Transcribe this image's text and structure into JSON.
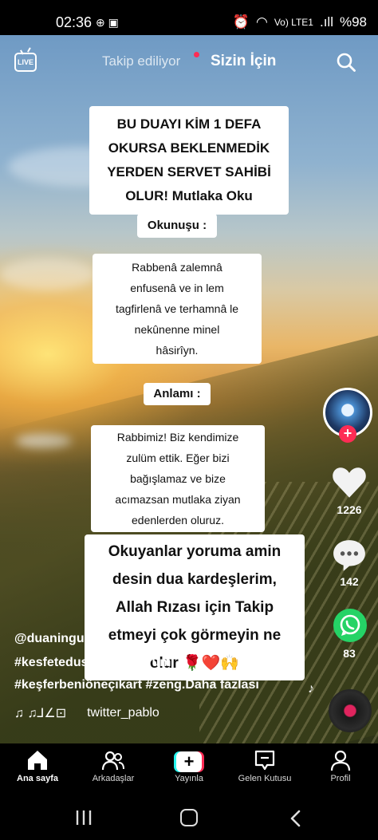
{
  "status_bar": {
    "time": "02:36",
    "notification_icons": "⊕ ▣",
    "network_label": "Vo) LTE1",
    "signal": ".ıll",
    "battery": "%98"
  },
  "top_nav": {
    "following_tab": "Takip ediliyor",
    "for_you_tab": "Sizin İçin",
    "live_label": "LIVE"
  },
  "captions": {
    "title_lines": [
      "BU DUAYI KİM 1 DEFA",
      "OKURSA BEKLENMEDİK",
      "YERDEN SERVET SAHİBİ",
      "OLUR! Mutlaka Oku"
    ],
    "reading_label": "Okunuşu :",
    "reading_lines": [
      "Rabbenâ zalemnâ",
      "enfusenâ ve in lem",
      "tagfirlenâ ve terhamnâ le",
      "nekûnenne minel",
      "hâsirîyn."
    ],
    "meaning_label": "Anlamı :",
    "meaning_lines": [
      "Rabbimiz! Biz kendimize",
      "zulüm ettik. Eğer bizi",
      "bağışlamaz ve bize",
      "acımazsan mutlaka ziyan",
      "edenlerden oluruz."
    ],
    "request_lines": [
      "Okuyanlar yoruma amin",
      "desin dua kardeşlerim,",
      "Allah Rızası için Takip",
      "etmeyi çok görmeyin ne",
      "olur 🌹❤️🙌"
    ]
  },
  "actions": {
    "likes": "1226",
    "comments": "142",
    "shares": "83",
    "follow_symbol": "+"
  },
  "post_info": {
    "username": "@duaningucu",
    "hashtags_line1": "#kesfetedusmekistiyorum",
    "hashtags_line2": "#keşferbeniöneçıkart #zeng.",
    "more_label": "Daha fazlası",
    "music_glyphs": "♫  ♫⅃∠⊡",
    "music_author": "twitter_pablo"
  },
  "bottom_nav": [
    {
      "label": "Ana sayfa"
    },
    {
      "label": "Arkadaşlar"
    },
    {
      "label": "Yayınla"
    },
    {
      "label": "Gelen Kutusu"
    },
    {
      "label": "Profil"
    }
  ],
  "colors": {
    "accent_red": "#fe2c55",
    "accent_cyan": "#25f4ee",
    "whatsapp_green": "#25d366",
    "caption_bg": "#ffffff"
  }
}
